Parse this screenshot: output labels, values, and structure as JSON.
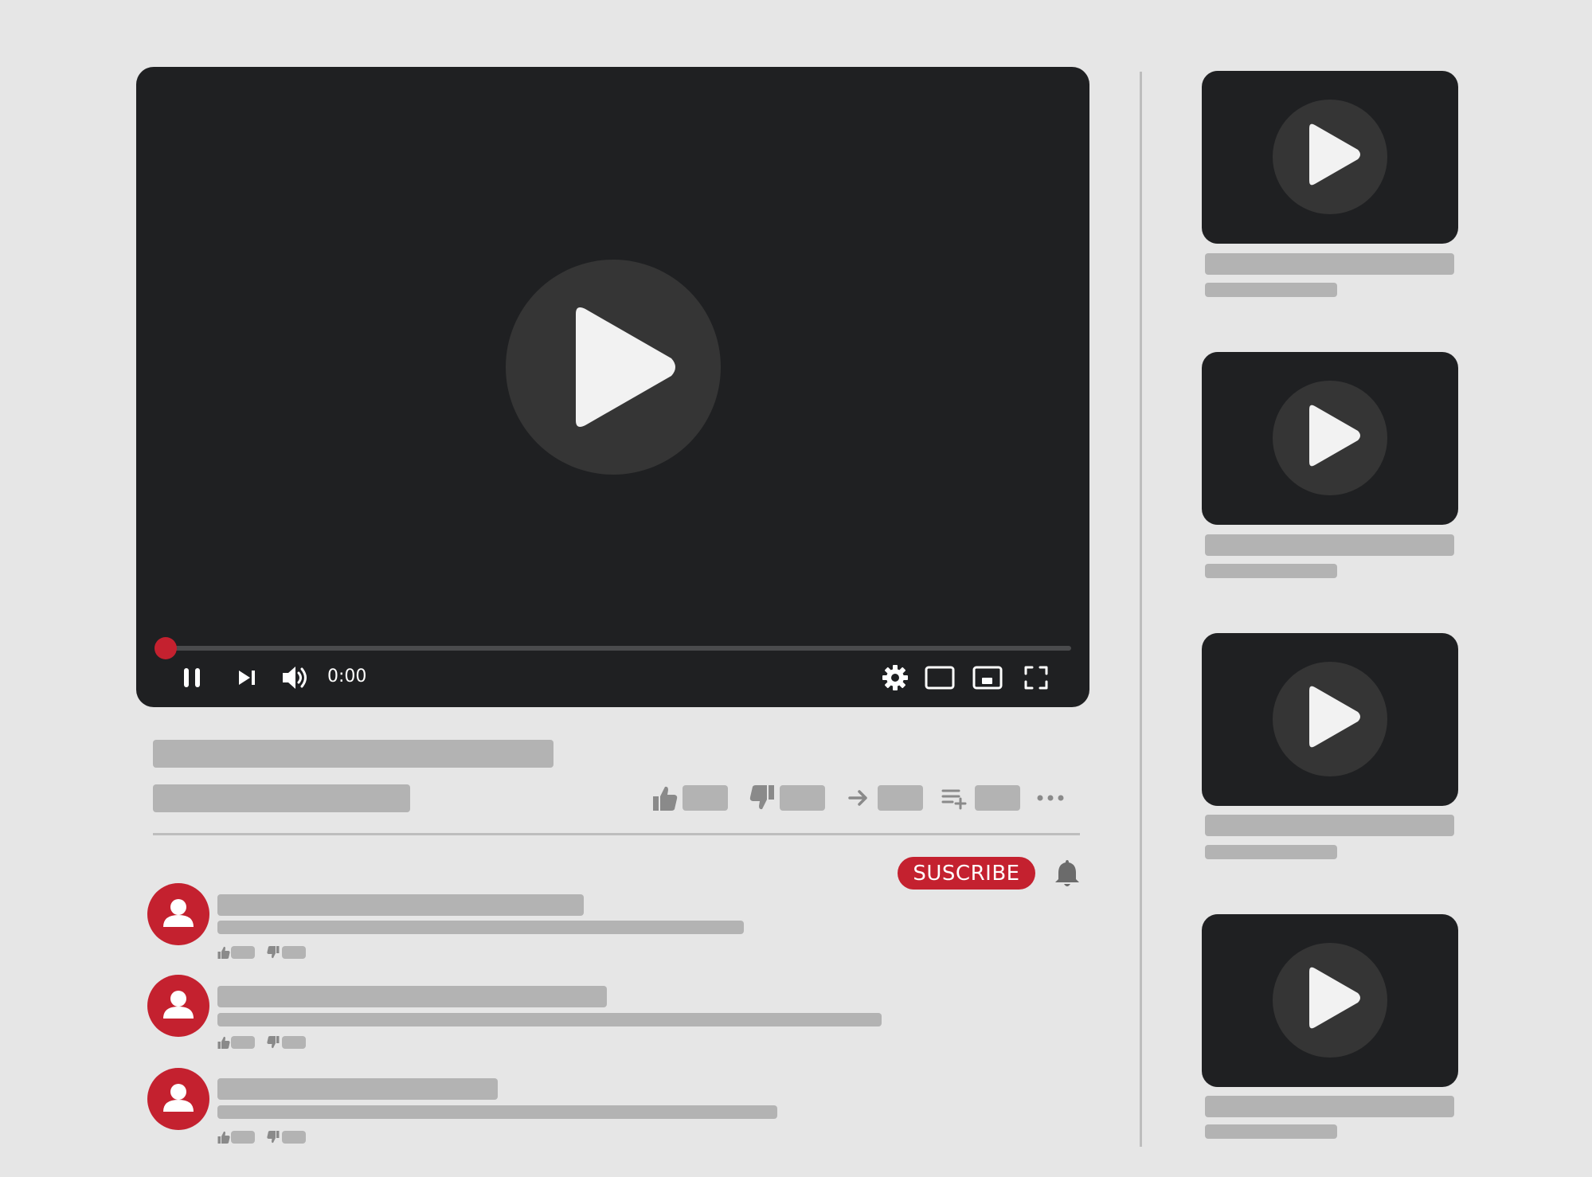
{
  "player": {
    "time": "0:00",
    "progress": 0,
    "controls": [
      "pause-icon",
      "skip-next-icon",
      "volume-icon",
      "gear-icon",
      "theater-mode-icon",
      "miniplayer-icon",
      "fullscreen-icon"
    ]
  },
  "actions": [
    "thumbs-up-icon",
    "thumbs-down-icon",
    "share-icon",
    "add-to-playlist-icon",
    "more-icon"
  ],
  "subscribe": {
    "label": "SUSCRIBE"
  },
  "colors": {
    "accent": "#c4212f",
    "player_bg": "#1f2022",
    "page_bg": "#e6e6e6",
    "placeholder": "#b3b3b3"
  }
}
